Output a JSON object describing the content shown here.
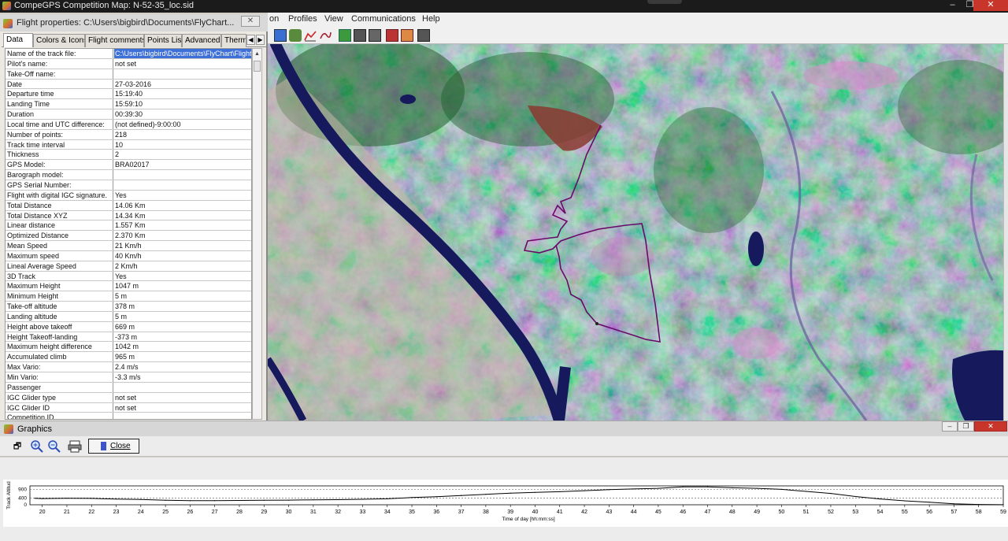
{
  "main_window": {
    "title": "CompeGPS Competition Map: N-52-35_loc.sid",
    "min_glyph": "–",
    "restore_glyph": "❐",
    "close_glyph": "✕"
  },
  "menu": [
    "on",
    "Profiles",
    "View",
    "Communications",
    "Help"
  ],
  "flight_properties": {
    "title": "Flight properties: C:\\Users\\bigbird\\Documents\\FlyChart...",
    "close_glyph": "✕",
    "tabs": [
      "Data",
      "Colors & Icons",
      "Flight comments:",
      "Points List",
      "Advanced",
      "Therm"
    ],
    "tab_prev": "◀",
    "tab_next": "▶",
    "rows": [
      {
        "name": "Name of the track file:",
        "value": "C:\\Users\\bigbird\\Documents\\FlyChart\\Flight"
      },
      {
        "name": "Pilot's name:",
        "value": "not set"
      },
      {
        "name": "Take-Off name:",
        "value": ""
      },
      {
        "name": "Date",
        "value": "27-03-2016"
      },
      {
        "name": "Departure time",
        "value": "15:19:40"
      },
      {
        "name": "Landing Time",
        "value": "15:59:10"
      },
      {
        "name": "Duration",
        "value": "00:39:30"
      },
      {
        "name": "Local time and UTC difference:",
        "value": " (not defined)-9:00:00"
      },
      {
        "name": "Number of points:",
        "value": "218"
      },
      {
        "name": "Track time interval",
        "value": "10"
      },
      {
        "name": "Thickness",
        "value": "2"
      },
      {
        "name": "GPS Model:",
        "value": "BRA02017"
      },
      {
        "name": "Barograph model:",
        "value": ""
      },
      {
        "name": "GPS Serial Number:",
        "value": ""
      },
      {
        "name": "Flight with digital IGC signature.",
        "value": "Yes"
      },
      {
        "name": "Total Distance",
        "value": "14.06 Km"
      },
      {
        "name": "Total Distance XYZ",
        "value": "14.34 Km"
      },
      {
        "name": "Linear distance",
        "value": "1.557 Km"
      },
      {
        "name": "Optimized Distance",
        "value": "2.370 Km"
      },
      {
        "name": "Mean Speed",
        "value": "21 Km/h"
      },
      {
        "name": "Maximum speed",
        "value": "40 Km/h"
      },
      {
        "name": "Lineal Average Speed",
        "value": "2 Km/h"
      },
      {
        "name": "3D Track",
        "value": "Yes"
      },
      {
        "name": "Maximum Height",
        "value": "1047 m"
      },
      {
        "name": "Minimum Height",
        "value": "5 m"
      },
      {
        "name": "Take-off altitude",
        "value": "378 m"
      },
      {
        "name": "Landing altitude",
        "value": "5 m"
      },
      {
        "name": "Height above takeoff",
        "value": "669 m"
      },
      {
        "name": "Height Takeoff-landing",
        "value": "-373 m"
      },
      {
        "name": "Maximum height difference",
        "value": "1042 m"
      },
      {
        "name": "Accumulated climb",
        "value": "965 m"
      },
      {
        "name": "Max Vario:",
        "value": "2.4 m/s"
      },
      {
        "name": "Min Vario:",
        "value": "-3.3 m/s"
      },
      {
        "name": "Passenger",
        "value": ""
      },
      {
        "name": "IGC Glider type",
        "value": "not set"
      },
      {
        "name": "IGC Glider ID",
        "value": "not set"
      },
      {
        "name": "Competition ID",
        "value": ""
      }
    ]
  },
  "graphics": {
    "title": "Graphics",
    "close_label": "Close",
    "min_glyph": "–",
    "restore_glyph": "❐",
    "close_glyph": "✕"
  },
  "chart_data": {
    "type": "line",
    "ylabel": "Track Altitud",
    "xlabel": "Time of day [hh:mm:ss]",
    "yticks": [
      "900",
      "400",
      "0"
    ],
    "xticks": [
      "20",
      "21",
      "22",
      "23",
      "24",
      "25",
      "26",
      "27",
      "28",
      "29",
      "30",
      "31",
      "32",
      "33",
      "34",
      "35",
      "36",
      "37",
      "38",
      "39",
      "40",
      "41",
      "42",
      "43",
      "44",
      "45",
      "46",
      "47",
      "48",
      "49",
      "50",
      "51",
      "52",
      "53",
      "54",
      "55",
      "56",
      "57",
      "58",
      "59"
    ],
    "ylim": [
      0,
      1100
    ],
    "grid": true,
    "series": [
      {
        "x": [
          19.7,
          20,
          21,
          22,
          23,
          24,
          25,
          26,
          27,
          28,
          29,
          30,
          31,
          32,
          33,
          34,
          35,
          36,
          37,
          38,
          39,
          40,
          41,
          42,
          43,
          44,
          45,
          46,
          47,
          48,
          49,
          50,
          51,
          52,
          53,
          54,
          55,
          56,
          57,
          58,
          59
        ],
        "values": [
          378,
          360,
          380,
          370,
          330,
          310,
          260,
          240,
          240,
          250,
          260,
          270,
          290,
          300,
          320,
          350,
          420,
          470,
          540,
          610,
          680,
          720,
          760,
          820,
          880,
          920,
          960,
          1040,
          1047,
          990,
          960,
          900,
          780,
          660,
          480,
          340,
          230,
          150,
          60,
          20,
          5
        ]
      }
    ]
  }
}
